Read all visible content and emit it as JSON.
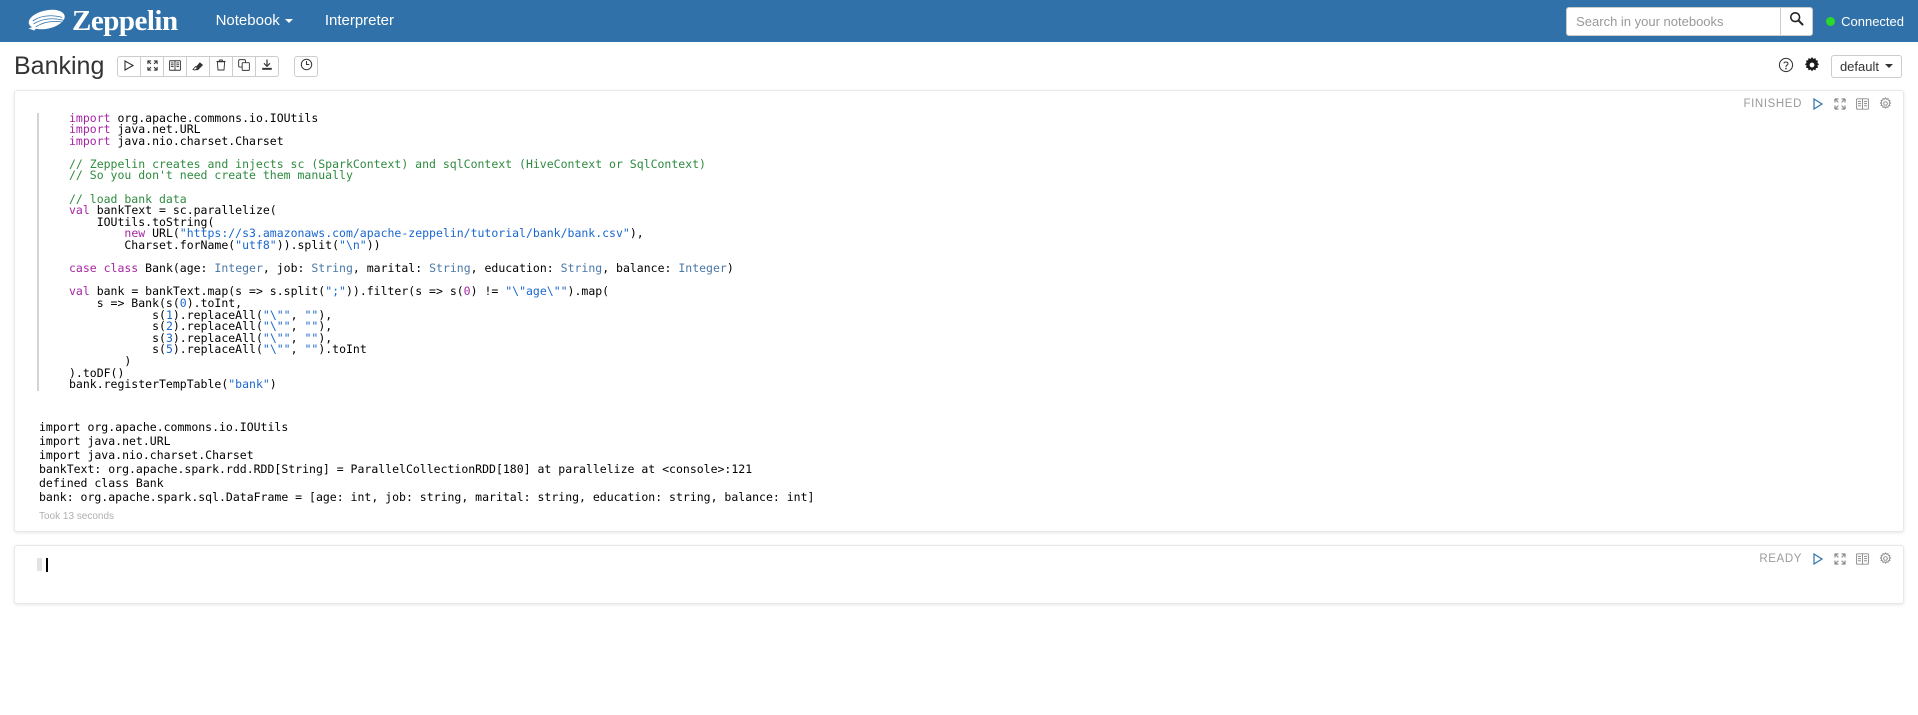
{
  "navbar": {
    "brand": "Zeppelin",
    "logo_icon": "zeppelin-airship-icon",
    "links": [
      {
        "label": "Notebook",
        "has_caret": true
      },
      {
        "label": "Interpreter",
        "has_caret": false
      }
    ],
    "search": {
      "placeholder": "Search in your notebooks",
      "value": "",
      "icon": "search-icon"
    },
    "connection": {
      "label": "Connected",
      "color": "#2bd92b"
    }
  },
  "notebook_header": {
    "title": "Banking",
    "toolbar": [
      {
        "name": "run-all-paragraphs-button",
        "icon": "play-icon",
        "label": "Run all paragraphs"
      },
      {
        "name": "toggle-collapse-button",
        "icon": "collapse-icon",
        "label": "Show/hide output"
      },
      {
        "name": "toggle-code-button",
        "icon": "book-icon",
        "label": "Show/hide code"
      },
      {
        "name": "clear-output-button",
        "icon": "eraser-icon",
        "label": "Clear output"
      },
      {
        "name": "delete-notebook-button",
        "icon": "trash-icon",
        "label": "Remove notebook"
      },
      {
        "name": "clone-notebook-button",
        "icon": "copy-icon",
        "label": "Clone notebook"
      },
      {
        "name": "export-notebook-button",
        "icon": "download-icon",
        "label": "Export notebook"
      }
    ],
    "version_control": {
      "name": "version-history-button",
      "icon": "clock-icon",
      "label": "Version control"
    },
    "help": {
      "icon": "question-circle-icon",
      "label": "Keyboard shortcuts"
    },
    "settings": {
      "icon": "gear-icon",
      "label": "Interpreter binding"
    },
    "interpreter": {
      "label": "default",
      "has_caret": true
    }
  },
  "paragraphs": [
    {
      "status": "FINISHED",
      "controls": [
        {
          "name": "run-paragraph-button",
          "icon": "play-icon"
        },
        {
          "name": "toggle-paragraph-output-button",
          "icon": "collapse-icon"
        },
        {
          "name": "toggle-paragraph-code-button",
          "icon": "book-icon"
        },
        {
          "name": "paragraph-settings-button",
          "icon": "gear-icon"
        }
      ],
      "code_lines": [
        [
          {
            "t": "import",
            "c": "k"
          },
          {
            "t": " org.apache.commons.io.IOUtils",
            "c": ""
          }
        ],
        [
          {
            "t": "import",
            "c": "k"
          },
          {
            "t": " java.net.URL",
            "c": ""
          }
        ],
        [
          {
            "t": "import",
            "c": "k"
          },
          {
            "t": " java.nio.charset.Charset",
            "c": ""
          }
        ],
        [],
        [
          {
            "t": "// Zeppelin creates and injects sc (SparkContext) and sqlContext (HiveContext or SqlContext)",
            "c": "c"
          }
        ],
        [
          {
            "t": "// So you don't need create them manually",
            "c": "c"
          }
        ],
        [],
        [
          {
            "t": "// load bank data",
            "c": "c"
          }
        ],
        [
          {
            "t": "val",
            "c": "k"
          },
          {
            "t": " bankText = sc.parallelize(",
            "c": ""
          }
        ],
        [
          {
            "t": "    IOUtils.toString(",
            "c": ""
          }
        ],
        [
          {
            "t": "        ",
            "c": ""
          },
          {
            "t": "new",
            "c": "k"
          },
          {
            "t": " URL(",
            "c": ""
          },
          {
            "t": "\"https://s3.amazonaws.com/apache-zeppelin/tutorial/bank/bank.csv\"",
            "c": "s"
          },
          {
            "t": "),",
            "c": ""
          }
        ],
        [
          {
            "t": "        Charset.forName(",
            "c": ""
          },
          {
            "t": "\"utf8\"",
            "c": "s"
          },
          {
            "t": ")).split(",
            "c": ""
          },
          {
            "t": "\"\\n\"",
            "c": "s"
          },
          {
            "t": "))",
            "c": ""
          }
        ],
        [],
        [
          {
            "t": "case class",
            "c": "k"
          },
          {
            "t": " Bank(age: ",
            "c": ""
          },
          {
            "t": "Integer",
            "c": "t"
          },
          {
            "t": ", job: ",
            "c": ""
          },
          {
            "t": "String",
            "c": "t"
          },
          {
            "t": ", marital: ",
            "c": ""
          },
          {
            "t": "String",
            "c": "t"
          },
          {
            "t": ", education: ",
            "c": ""
          },
          {
            "t": "String",
            "c": "t"
          },
          {
            "t": ", balance: ",
            "c": ""
          },
          {
            "t": "Integer",
            "c": "t"
          },
          {
            "t": ")",
            "c": ""
          }
        ],
        [],
        [
          {
            "t": "val",
            "c": "k"
          },
          {
            "t": " bank = bankText.map(s => s.split(",
            "c": ""
          },
          {
            "t": "\";\"",
            "c": "s"
          },
          {
            "t": ")).filter(s => s(",
            "c": ""
          },
          {
            "t": "0",
            "c": "np"
          },
          {
            "t": ") != ",
            "c": ""
          },
          {
            "t": "\"\\\"age\\\"\"",
            "c": "s"
          },
          {
            "t": ").map(",
            "c": ""
          }
        ],
        [
          {
            "t": "    s => Bank(s(",
            "c": ""
          },
          {
            "t": "0",
            "c": "n"
          },
          {
            "t": ").toInt,",
            "c": ""
          }
        ],
        [
          {
            "t": "            s(",
            "c": ""
          },
          {
            "t": "1",
            "c": "n"
          },
          {
            "t": ").replaceAll(",
            "c": ""
          },
          {
            "t": "\"\\\"\"",
            "c": "s"
          },
          {
            "t": ", ",
            "c": ""
          },
          {
            "t": "\"\"",
            "c": "s"
          },
          {
            "t": "),",
            "c": ""
          }
        ],
        [
          {
            "t": "            s(",
            "c": ""
          },
          {
            "t": "2",
            "c": "n"
          },
          {
            "t": ").replaceAll(",
            "c": ""
          },
          {
            "t": "\"\\\"\"",
            "c": "s"
          },
          {
            "t": ", ",
            "c": ""
          },
          {
            "t": "\"\"",
            "c": "s"
          },
          {
            "t": "),",
            "c": ""
          }
        ],
        [
          {
            "t": "            s(",
            "c": ""
          },
          {
            "t": "3",
            "c": "n"
          },
          {
            "t": ").replaceAll(",
            "c": ""
          },
          {
            "t": "\"\\\"\"",
            "c": "s"
          },
          {
            "t": ", ",
            "c": ""
          },
          {
            "t": "\"\"",
            "c": "s"
          },
          {
            "t": "),",
            "c": ""
          }
        ],
        [
          {
            "t": "            s(",
            "c": ""
          },
          {
            "t": "5",
            "c": "n"
          },
          {
            "t": ").replaceAll(",
            "c": ""
          },
          {
            "t": "\"\\\"\"",
            "c": "s"
          },
          {
            "t": ", ",
            "c": ""
          },
          {
            "t": "\"\"",
            "c": "s"
          },
          {
            "t": ").toInt",
            "c": ""
          }
        ],
        [
          {
            "t": "        )",
            "c": ""
          }
        ],
        [
          {
            "t": ").toDF()",
            "c": ""
          }
        ],
        [
          {
            "t": "bank.registerTempTable(",
            "c": ""
          },
          {
            "t": "\"bank\"",
            "c": "s"
          },
          {
            "t": ")",
            "c": ""
          }
        ]
      ],
      "output_lines": [
        "import org.apache.commons.io.IOUtils",
        "import java.net.URL",
        "import java.nio.charset.Charset",
        "bankText: org.apache.spark.rdd.RDD[String] = ParallelCollectionRDD[180] at parallelize at <console>:121",
        "defined class Bank",
        "bank: org.apache.spark.sql.DataFrame = [age: int, job: string, marital: string, education: string, balance: int]"
      ],
      "took": "Took 13 seconds"
    },
    {
      "status": "READY",
      "controls": [
        {
          "name": "run-paragraph-button",
          "icon": "play-icon"
        },
        {
          "name": "toggle-paragraph-output-button",
          "icon": "collapse-icon"
        },
        {
          "name": "toggle-paragraph-code-button",
          "icon": "book-icon"
        },
        {
          "name": "paragraph-settings-button",
          "icon": "gear-icon"
        }
      ],
      "code_lines": [],
      "output_lines": [],
      "took": ""
    }
  ],
  "colors": {
    "navbar_bg": "#3071a9",
    "accent_blue": "#3071a9",
    "connected_green": "#2bd92b",
    "keyword_purple": "#a626a4",
    "comment_green": "#2e8b3f",
    "string_blue": "#1a66d0",
    "type_blue": "#4a78a8"
  }
}
